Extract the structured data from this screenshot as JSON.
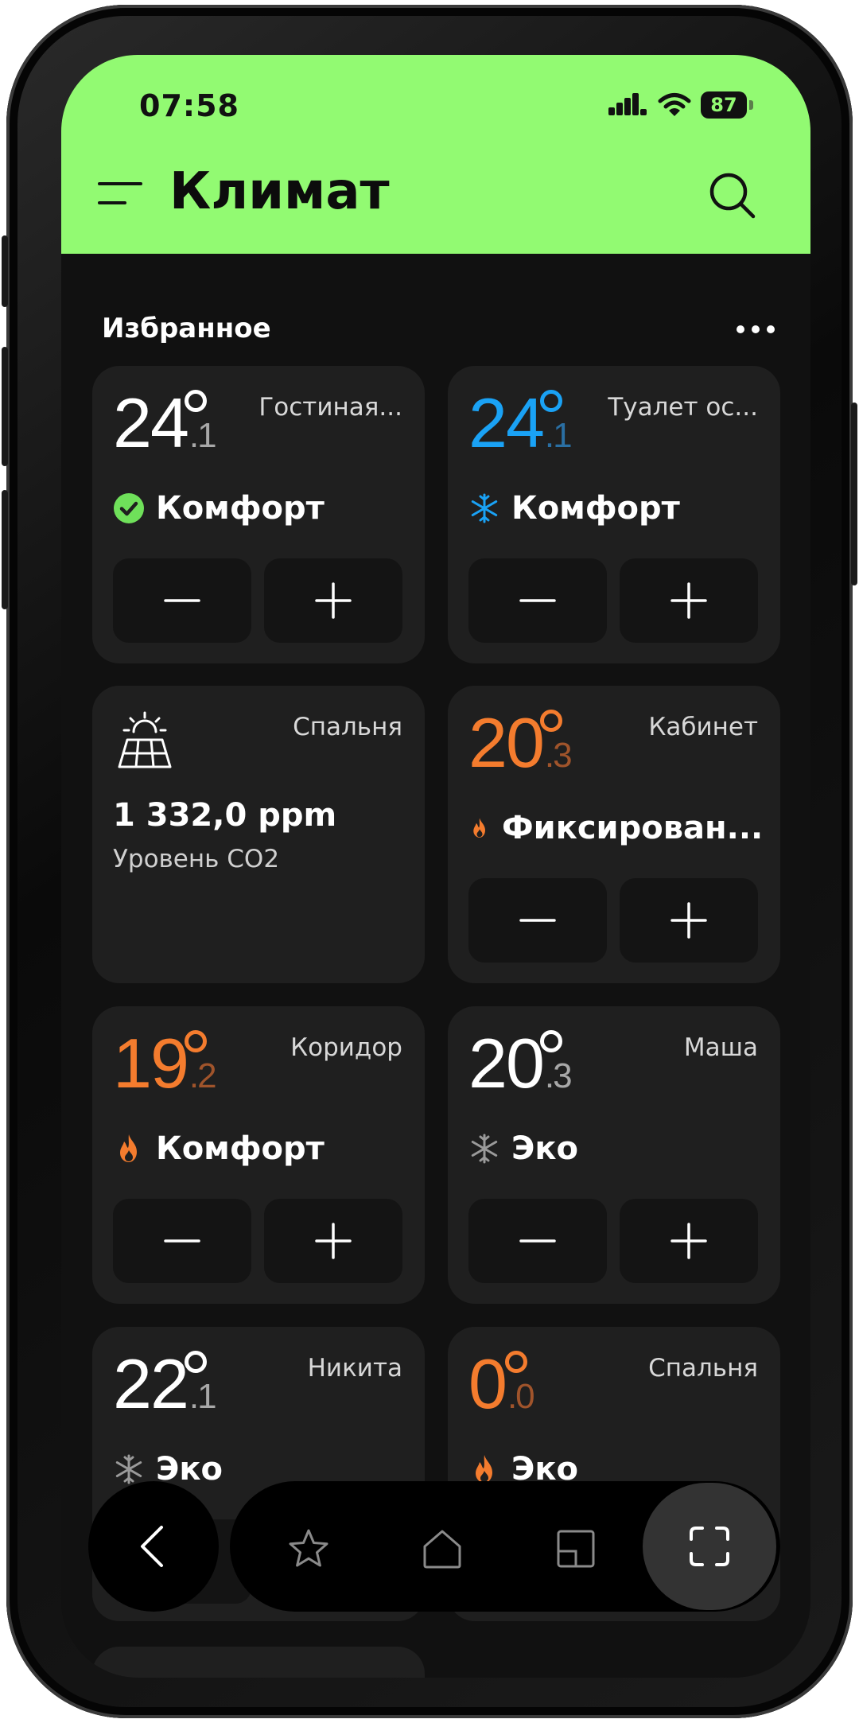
{
  "status_bar": {
    "time": "07:58",
    "battery": "87"
  },
  "header": {
    "title": "Климат"
  },
  "section": {
    "title": "Избранное"
  },
  "cards": [
    {
      "temp_int": "24",
      "temp_dec": ".1",
      "name": "Гостиная...",
      "mode": "Комфорт",
      "mode_icon": "check-circle-icon",
      "temp_color": "#ffffff"
    },
    {
      "temp_int": "24",
      "temp_dec": ".1",
      "name": "Туалет ос...",
      "mode": "Комфорт",
      "mode_icon": "snowflake-icon",
      "temp_color": "#1aa2f5"
    },
    {
      "type": "sensor",
      "name": "Спальня",
      "value": "1 332,0 ppm",
      "label": "Уровень CO2",
      "icon": "solar-panel-icon"
    },
    {
      "temp_int": "20",
      "temp_dec": ".3",
      "name": "Кабинет",
      "mode": "Фиксирован...",
      "mode_icon": "flame-icon",
      "temp_color": "#f47c2e"
    },
    {
      "temp_int": "19",
      "temp_dec": ".2",
      "name": "Коридор",
      "mode": "Комфорт",
      "mode_icon": "flame-icon",
      "temp_color": "#f47c2e"
    },
    {
      "temp_int": "20",
      "temp_dec": ".3",
      "name": "Маша",
      "mode": "Эко",
      "mode_icon": "snowflake-icon",
      "temp_color": "#ffffff"
    },
    {
      "temp_int": "22",
      "temp_dec": ".1",
      "name": "Никита",
      "mode": "Эко",
      "mode_icon": "snowflake-icon",
      "temp_color": "#ffffff"
    },
    {
      "temp_int": "0",
      "temp_dec": ".0",
      "name": "Спальня",
      "mode": "Эко",
      "mode_icon": "flame-icon",
      "temp_color": "#f47c2e"
    }
  ],
  "colors": {
    "accent": "#92fa72",
    "background": "#111111",
    "card": "#1f1f1f",
    "heat": "#f47c2e",
    "cool": "#1aa2f5",
    "ok": "#6fe05a"
  },
  "nav": {
    "items": [
      "back-icon",
      "star-icon",
      "home-icon",
      "rooms-icon",
      "scan-icon"
    ]
  }
}
